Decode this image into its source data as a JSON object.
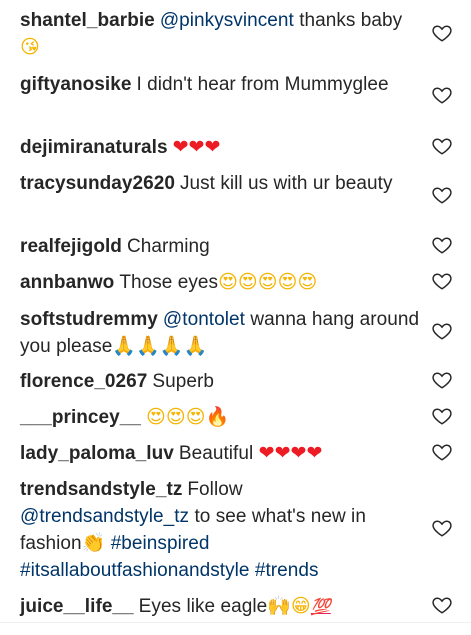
{
  "comments": [
    {
      "user": "shantel_barbie",
      "mention": "@pinkysvincent",
      "text": " thanks baby ",
      "emoji": "😘"
    },
    {
      "user": "giftyanosike",
      "text": "I didn't hear from Mummyglee"
    },
    {
      "user": "dejimiranaturals",
      "emoji": "❤❤❤"
    },
    {
      "user": "tracysunday2620",
      "text": "Just kill us with ur beauty"
    },
    {
      "user": "realfejigold",
      "text": "Charming"
    },
    {
      "user": "annbanwo",
      "text": "Those eyes",
      "emoji": "😍😍😍😍😍"
    },
    {
      "user": "softstudremmy",
      "mention": "@tontolet",
      "text": " wanna hang around you please",
      "emoji": "🙏🙏🙏🙏"
    },
    {
      "user": "florence_0267",
      "text": "Superb"
    },
    {
      "user": "___princey__",
      "emoji": "😍😍😍",
      "emoji2": "🔥"
    },
    {
      "user": "lady_paloma_luv",
      "text": "Beautiful ",
      "emoji": "❤❤❤❤"
    },
    {
      "user": "trendsandstyle_tz",
      "text": "Follow",
      "mention": "@trendsandstyle_tz",
      "text2": " to see what's new in fashion",
      "emoji": "👏",
      "tag1": "#beinspired",
      "tag2": "#itsallaboutfashionandstyle",
      "tag3": "#trends"
    },
    {
      "user": "juice__life__",
      "text": "Eyes like eagle",
      "emoji": "🙌😁",
      "emoji2": "💯"
    }
  ],
  "icons": {
    "like": "heart-outline-icon"
  },
  "colors": {
    "text": "#262626",
    "link": "#003569",
    "heart": "#ed1c24"
  }
}
